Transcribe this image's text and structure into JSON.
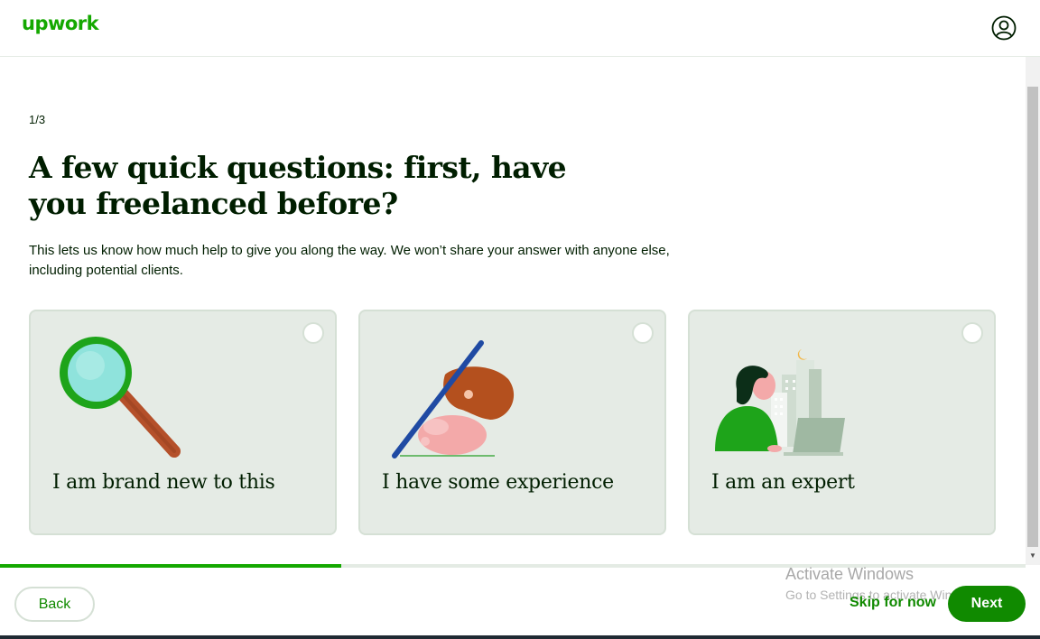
{
  "header": {
    "logo_text": "upwork",
    "account_icon": "user-circle-icon"
  },
  "page": {
    "step": "1/3",
    "title": "A few quick questions: first, have you freelanced before?",
    "subtitle": "This lets us know how much help to give you along the way. We won’t share your answer with anyone else, including potential clients."
  },
  "options": [
    {
      "label": "I am brand new to this",
      "icon": "magnifying-glass-illustration",
      "selected": false
    },
    {
      "label": "I have some experience",
      "icon": "hand-writing-illustration",
      "selected": false
    },
    {
      "label": "I am an expert",
      "icon": "person-laptop-city-illustration",
      "selected": false
    }
  ],
  "progress": {
    "fraction": 0.333
  },
  "footer": {
    "back_label": "Back",
    "skip_label": "Skip for now",
    "next_label": "Next"
  },
  "watermark": {
    "title": "Activate Windows",
    "subtitle": "Go to Settings to activate Windows."
  },
  "colors": {
    "brand_green": "#14a800",
    "button_green": "#108a00",
    "card_bg": "#e5ebe5"
  }
}
